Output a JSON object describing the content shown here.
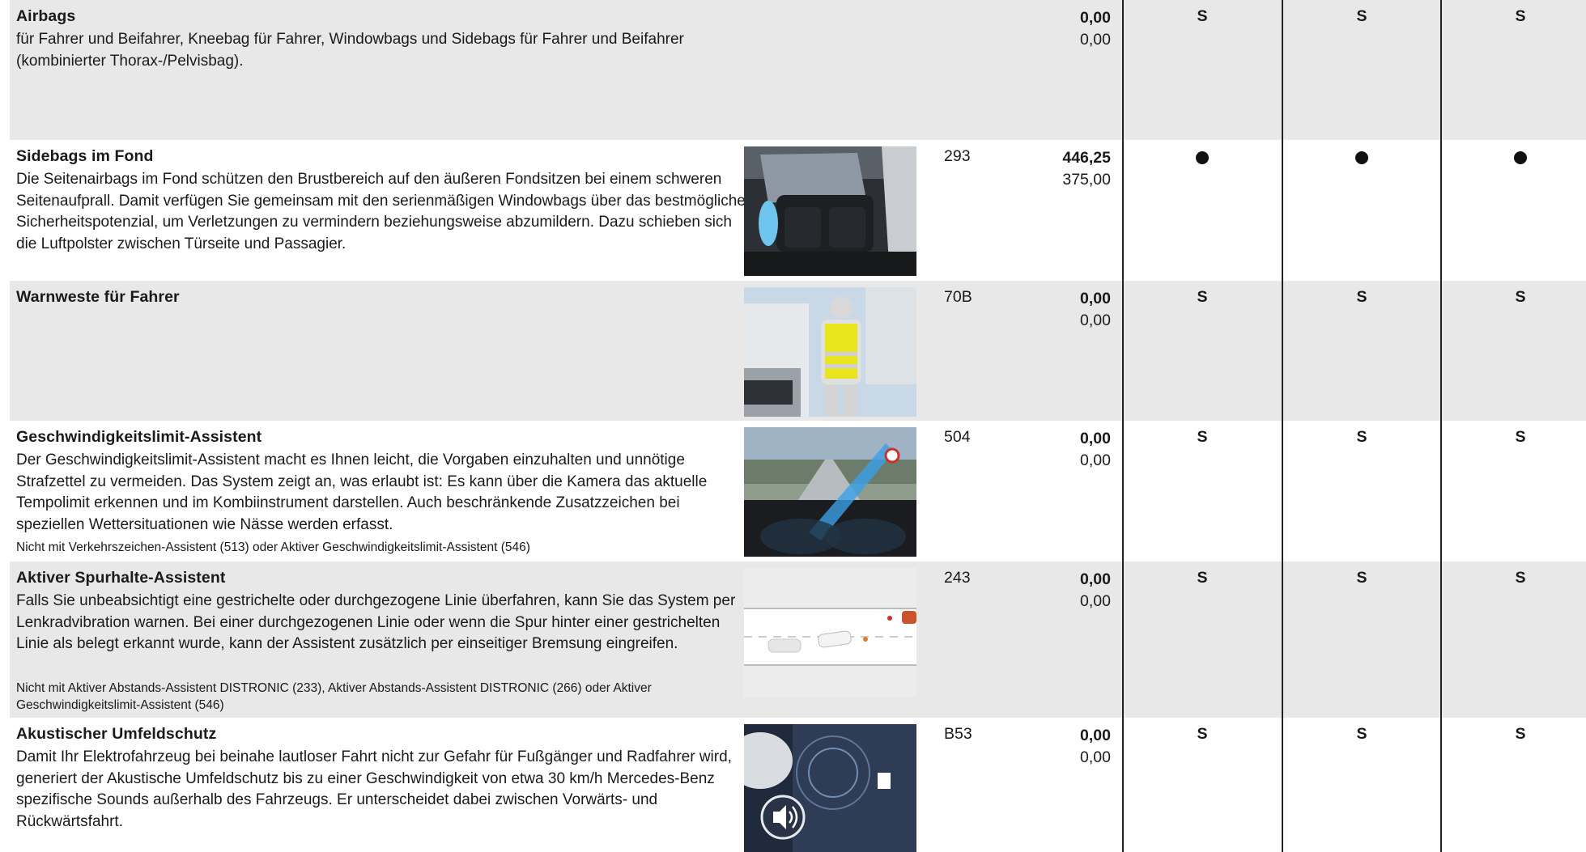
{
  "rows": [
    {
      "title": "Airbags",
      "description": "für Fahrer und Beifahrer, Kneebag für Fahrer, Windowbags und Sidebags für Fahrer und Beifahrer (kombinierter Thorax-/Pelvisbag).",
      "note": "",
      "code": "",
      "price_gross": "0,00",
      "price_net": "0,00",
      "marks": [
        "S",
        "S",
        "S"
      ]
    },
    {
      "title": "Sidebags im Fond",
      "description": "Die Seitenairbags im Fond schützen den Brustbereich auf den äußeren Fondsitzen bei einem schweren Seitenaufprall. Damit verfügen Sie gemeinsam mit den serienmäßigen Windowbags über das bestmögliche Sicherheitspotenzial, um Verletzungen zu vermindern beziehungsweise abzumildern. Dazu schieben sich die Luftpolster zwischen Türseite und Passagier.",
      "note": "",
      "code": "293",
      "price_gross": "446,25",
      "price_net": "375,00",
      "marks": [
        "●",
        "●",
        "●"
      ],
      "image": "rear-seat-sidebag-photo"
    },
    {
      "title": "Warnweste für Fahrer",
      "description": "",
      "note": "",
      "code": "70B",
      "price_gross": "0,00",
      "price_net": "0,00",
      "marks": [
        "S",
        "S",
        "S"
      ],
      "image": "driver-safety-vest-photo"
    },
    {
      "title": "Geschwindigkeitslimit-Assistent",
      "description": "Der Geschwindigkeitslimit-Assistent macht es Ihnen leicht, die Vorgaben einzuhalten und unnötige Strafzettel zu vermeiden. Das System zeigt an, was erlaubt ist: Es kann über die Kamera das aktuelle Tempolimit erkennen und im Kombiinstrument darstellen. Auch beschränkende Zusatzzeichen bei speziellen Wettersituationen wie Nässe werden erfasst.",
      "note": "Nicht mit Verkehrszeichen-Assistent (513) oder Aktiver Geschwindigkeitslimit-Assistent (546)",
      "code": "504",
      "price_gross": "0,00",
      "price_net": "0,00",
      "marks": [
        "S",
        "S",
        "S"
      ],
      "image": "speed-limit-cockpit-photo"
    },
    {
      "title": "Aktiver Spurhalte-Assistent",
      "description": "Falls Sie unbeabsichtigt eine gestrichelte oder durchgezogene Linie überfahren, kann Sie das System per Lenkradvibration warnen. Bei einer durchgezogenen Linie oder wenn die Spur hinter einer gestrichelten Linie als belegt erkannt wurde, kann der Assistent zusätzlich per einseitiger Bremsung eingreifen.",
      "note": "Nicht mit Aktiver Abstands-Assistent DISTRONIC (233), Aktiver Abstands-Assistent DISTRONIC (266) oder Aktiver Geschwindigkeitslimit-Assistent (546)",
      "code": "243",
      "price_gross": "0,00",
      "price_net": "0,00",
      "marks": [
        "S",
        "S",
        "S"
      ],
      "image": "lane-keeping-diagram"
    },
    {
      "title": "Akustischer Umfeldschutz",
      "description": "Damit Ihr Elektrofahrzeug bei beinahe lautloser Fahrt nicht zur Gefahr für Fußgänger und Radfahrer wird, generiert der Akustische Umfeldschutz bis zu einer Geschwindigkeit von etwa 30 km/h Mercedes-Benz spezifische Sounds außerhalb des Fahrzeugs. Er unterscheidet dabei zwischen Vorwärts- und Rückwärtsfahrt.",
      "note": "",
      "code": "B53",
      "price_gross": "0,00",
      "price_net": "0,00",
      "marks": [
        "S",
        "S",
        "S"
      ],
      "image": "acoustic-pedestrian-warning-photo"
    }
  ],
  "colors": {
    "shaded_row": "#e8e8e8",
    "divider": "#222222",
    "text": "#1a1a1a"
  }
}
